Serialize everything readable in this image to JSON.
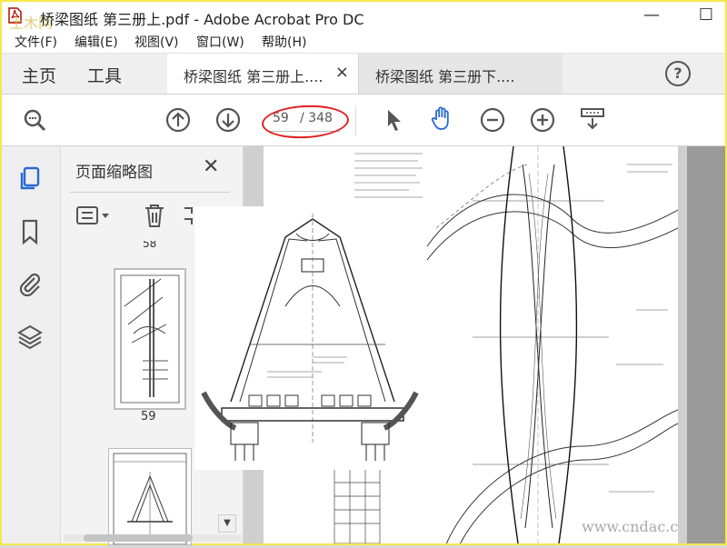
{
  "window": {
    "title": "桥梁图纸 第三册上.pdf - Adobe Acrobat Pro DC",
    "minimize_glyph": "—",
    "maximize_glyph": "☐"
  },
  "menu": [
    "文件(F)",
    "编辑(E)",
    "视图(V)",
    "窗口(W)",
    "帮助(H)"
  ],
  "tabs": {
    "home": "主页",
    "tools": "工具",
    "documents": [
      {
        "label": "桥梁图纸 第三册上....",
        "close": "×"
      },
      {
        "label": "桥梁图纸 第三册下...."
      }
    ],
    "help_glyph": "?"
  },
  "toolbar": {
    "current_page": "59",
    "total_pages": "/ 348"
  },
  "panel": {
    "title": "页面缩略图",
    "close_glyph": "✕",
    "thumb_prev_label": "58",
    "thumb_current_label": "59"
  },
  "watermarks": {
    "top": "土木网",
    "bottom": "www.cndac.c"
  },
  "colors": {
    "accent_blue": "#2a6ad1",
    "annotation_red": "#e02020",
    "window_border": "#f6e84a"
  }
}
